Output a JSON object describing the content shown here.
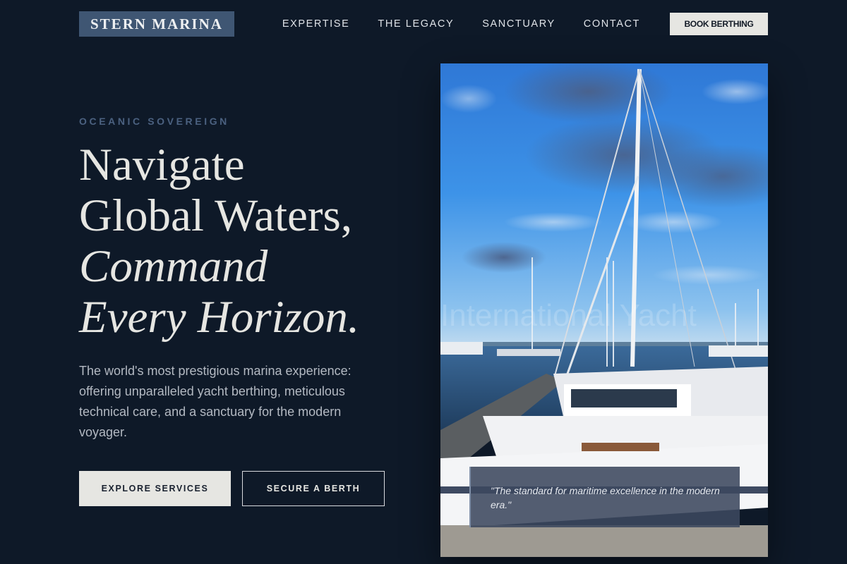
{
  "nav": {
    "logo": "STERN MARINA",
    "links": [
      "EXPERTISE",
      "THE LEGACY",
      "SANCTUARY",
      "CONTACT"
    ],
    "cta": "BOOK BERTHING"
  },
  "hero": {
    "eyebrow": "OCEANIC SOVEREIGN",
    "headline": {
      "line1": "Navigate",
      "line2": "Global Waters,",
      "line3": "Command",
      "line4": "Every Horizon."
    },
    "lead": "The world's most prestigious marina experience: offering unparalleled yacht berthing, meticulous technical care, and a sanctuary for the modern voyager.",
    "primary_cta": "EXPLORE SERVICES",
    "secondary_cta": "SECURE A BERTH",
    "image_watermark": "International Yacht",
    "quote": "\"The standard for maritime excellence in the modern era.\""
  },
  "colors": {
    "background": "#0e1928",
    "logo_bg": "#3f5673",
    "accent_text": "#4b6180",
    "light": "#e6e6e2"
  }
}
